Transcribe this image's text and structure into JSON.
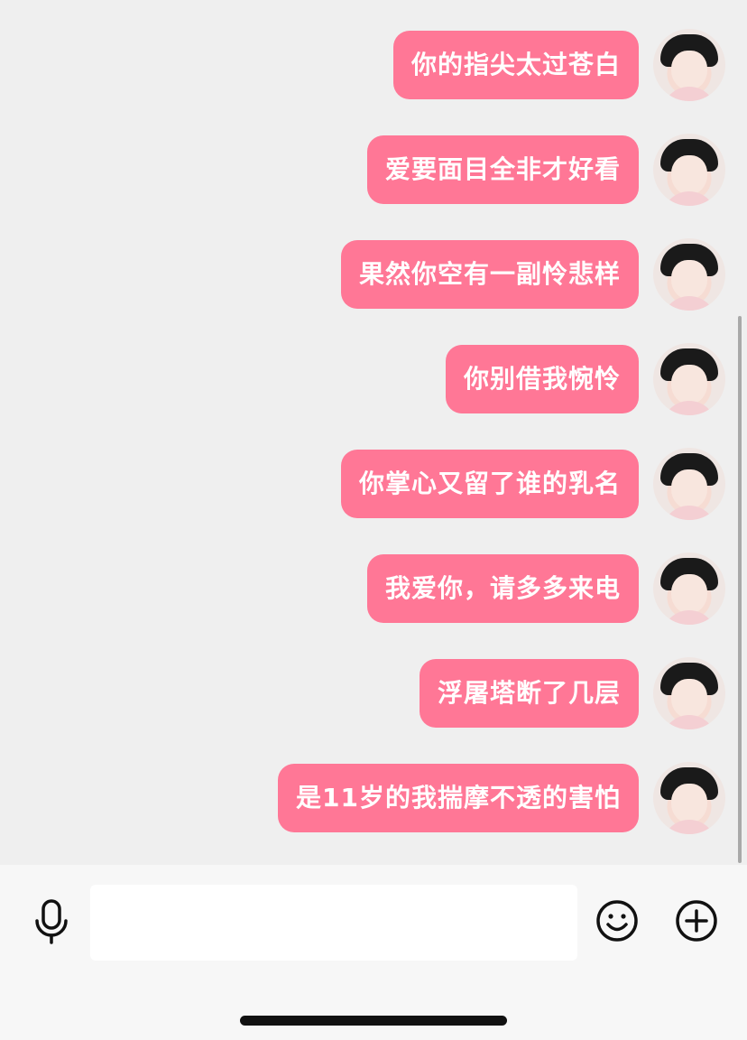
{
  "messages": [
    {
      "text": "你的指尖太过苍白"
    },
    {
      "text": "爱要面目全非才好看"
    },
    {
      "text": "果然你空有一副怜悲样"
    },
    {
      "text": "你别借我惋怜"
    },
    {
      "text": "你掌心又留了谁的乳名"
    },
    {
      "text": "我爱你，请多多来电"
    },
    {
      "text": "浮屠塔断了几层"
    },
    {
      "text": "是11岁的我揣摩不透的害怕"
    }
  ],
  "input_bar": {
    "value": "",
    "voice_icon": "microphone-icon",
    "emoji_icon": "smiley-icon",
    "more_icon": "plus-circle-icon"
  },
  "colors": {
    "bubble": "#ff7796",
    "bubble_text": "#ffffff",
    "background": "#efefef",
    "input_bar": "#f7f7f7"
  }
}
